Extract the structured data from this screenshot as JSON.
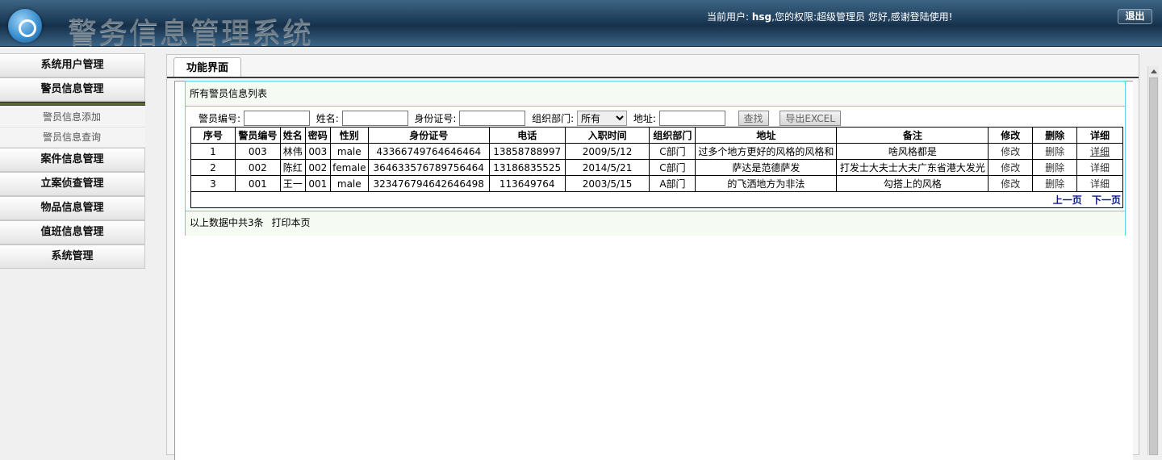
{
  "header": {
    "app_title": "警务信息管理系统",
    "user_prefix": "当前用户:",
    "user_name": "hsg",
    "role_text": ",您的权限:超级管理员 您好,感谢登陆使用!",
    "logout_label": "退出"
  },
  "sidebar": {
    "items": [
      {
        "label": "系统用户管理"
      },
      {
        "label": "警员信息管理"
      },
      {
        "label": "案件信息管理"
      },
      {
        "label": "立案侦查管理"
      },
      {
        "label": "物品信息管理"
      },
      {
        "label": "值班信息管理"
      },
      {
        "label": "系统管理"
      }
    ],
    "submenu": [
      {
        "label": "警员信息添加"
      },
      {
        "label": "警员信息查询"
      }
    ]
  },
  "main": {
    "tab_label": "功能界面",
    "list_title": "所有警员信息列表",
    "filters": {
      "police_no_label": "警员编号:",
      "police_no_value": "",
      "name_label": "姓名:",
      "name_value": "",
      "id_label": "身份证号:",
      "id_value": "",
      "dept_label": "组织部门:",
      "dept_selected": "所有",
      "address_label": "地址:",
      "address_value": "",
      "search_label": "查找",
      "export_label": "导出EXCEL"
    },
    "columns": [
      "序号",
      "警员编号",
      "姓名",
      "密码",
      "性别",
      "身份证号",
      "电话",
      "入职时间",
      "组织部门",
      "地址",
      "备注",
      "修改",
      "删除",
      "详细"
    ],
    "rows": [
      {
        "seq": "1",
        "no": "003",
        "name": "林伟",
        "pwd": "003",
        "gender": "male",
        "id": "43366749764646464",
        "phone": "13858788997",
        "date": "2009/5/12",
        "dept": "C部门",
        "addr": "过多个地方更好的风格的风格和",
        "note": "啥风格都是",
        "edit": "修改",
        "del": "删除",
        "detail": "详细"
      },
      {
        "seq": "2",
        "no": "002",
        "name": "陈红",
        "pwd": "002",
        "gender": "female",
        "id": "364633576789756464",
        "phone": "13186835525",
        "date": "2014/5/21",
        "dept": "C部门",
        "addr": "萨达是范德萨发",
        "note": "打发士大夫士大夫广东省港大发光",
        "edit": "修改",
        "del": "删除",
        "detail": "详细"
      },
      {
        "seq": "3",
        "no": "001",
        "name": "王一",
        "pwd": "001",
        "gender": "male",
        "id": "323476794642646498",
        "phone": "113649764",
        "date": "2003/5/15",
        "dept": "A部门",
        "addr": "的飞洒地方为非法",
        "note": "勾搭上的风格",
        "edit": "修改",
        "del": "删除",
        "detail": "详细"
      }
    ],
    "pager": {
      "prev": "上一页",
      "next": "下一页"
    },
    "summary_text": "以上数据中共3条",
    "print_label": "打印本页"
  }
}
